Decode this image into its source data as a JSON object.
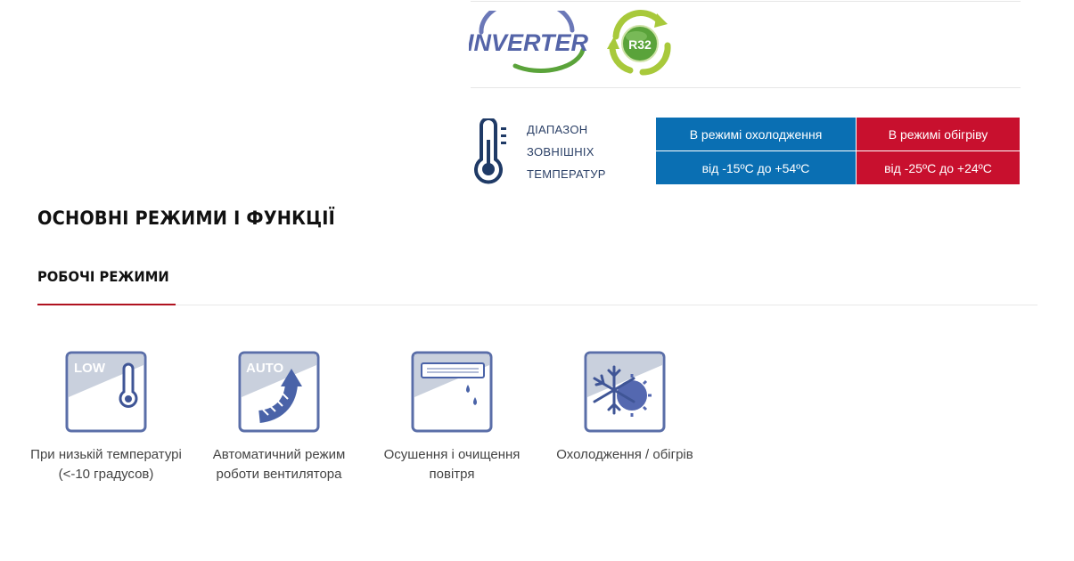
{
  "badges": {
    "inverter_text": "INVERTER",
    "r32_text": "R32"
  },
  "range": {
    "label": "ДІАПАЗОН\nЗОВНІШНІХ\nТЕМПЕРАТУР",
    "cooling_header": "В режимі охолодження",
    "heating_header": "В режимі обігріву",
    "cooling_value": "від -15ºC до +54ºC",
    "heating_value": "від -25ºC до +24ºC"
  },
  "section": {
    "title": "ОСНОВНІ РЕЖИМИ І ФУНКЦІЇ",
    "tab_title": "РОБОЧІ РЕЖИМИ"
  },
  "features": [
    {
      "icon_text": "LOW",
      "caption": "При низькій температурі (<-10 градусов)"
    },
    {
      "icon_text": "AUTO",
      "caption": "Автоматичний режим роботи вентилятора"
    },
    {
      "icon_text": "",
      "caption": "Осушення і очищення повітря"
    },
    {
      "icon_text": "",
      "caption": "Охолодження / обігрів"
    }
  ],
  "colors": {
    "cooling": "#0a6fb3",
    "heating": "#c8102e",
    "accent_underline": "#b0121f",
    "icon_frame": "#5a6ea8"
  }
}
